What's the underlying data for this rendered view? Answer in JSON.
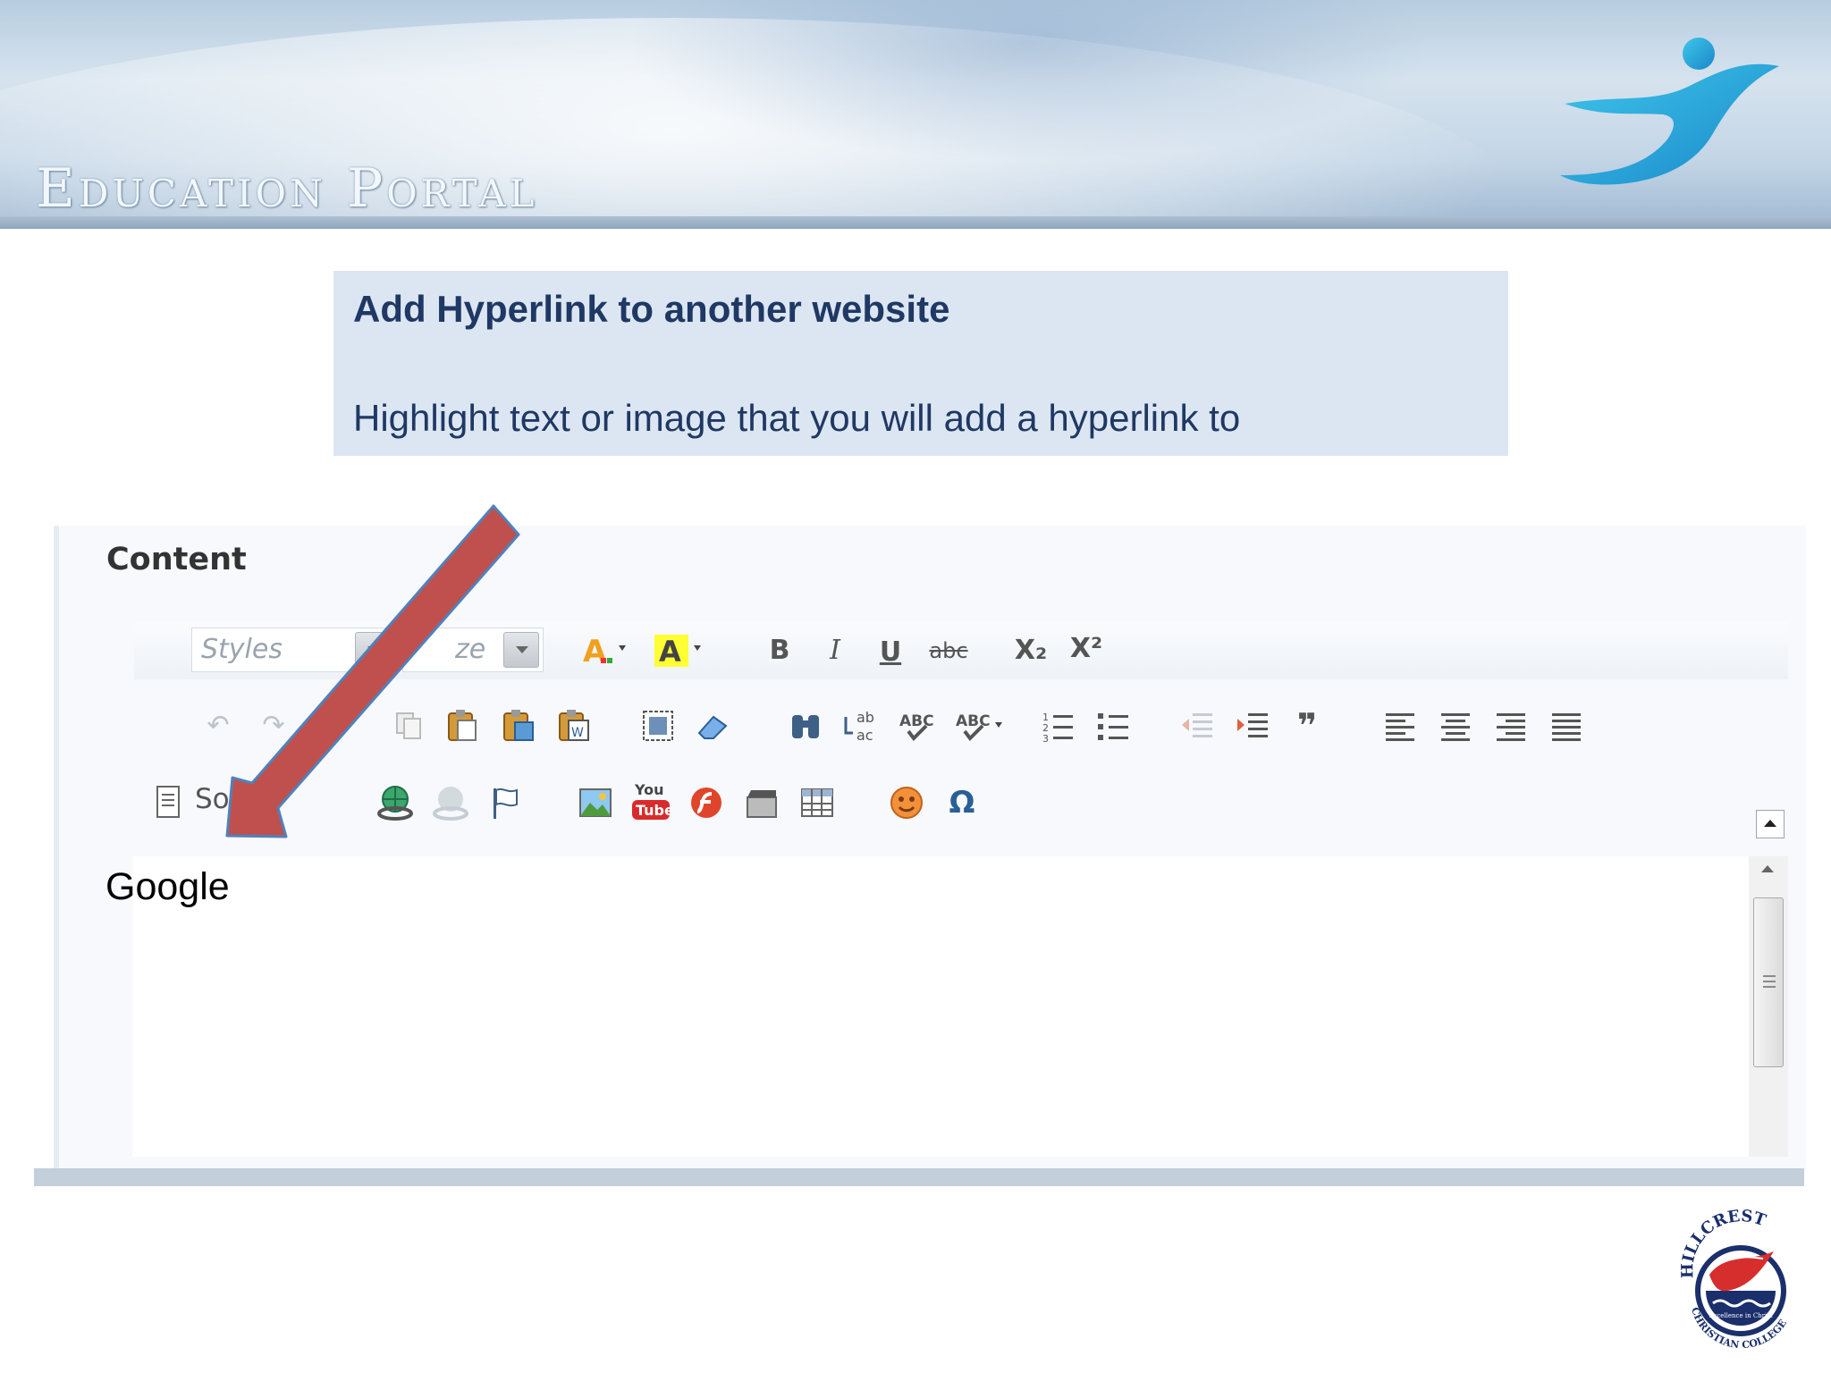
{
  "banner": {
    "title": "Education Portal"
  },
  "instruction": {
    "title": "Add Hyperlink to another website",
    "body": "Highlight text or image that you will add a hyperlink to"
  },
  "editor": {
    "section_label": "Content",
    "toolbar": {
      "styles_combo": "Styles",
      "size_combo_visible": "ze",
      "source_label": "So",
      "bold": "B",
      "italic": "I",
      "underline": "U",
      "strike": "abc",
      "subscript": "X₂",
      "superscript": "X²"
    },
    "content_text": "Google"
  },
  "school_logo": {
    "name_top": "HILLCREST",
    "name_bottom": "CHRISTIAN COLLEGE",
    "motto": "Excellence in Christ"
  },
  "colors": {
    "instruction_bg": "#dce6f2",
    "instruction_text": "#1f3864",
    "arrow_fill": "#c0504d",
    "arrow_stroke": "#4f81bd"
  }
}
